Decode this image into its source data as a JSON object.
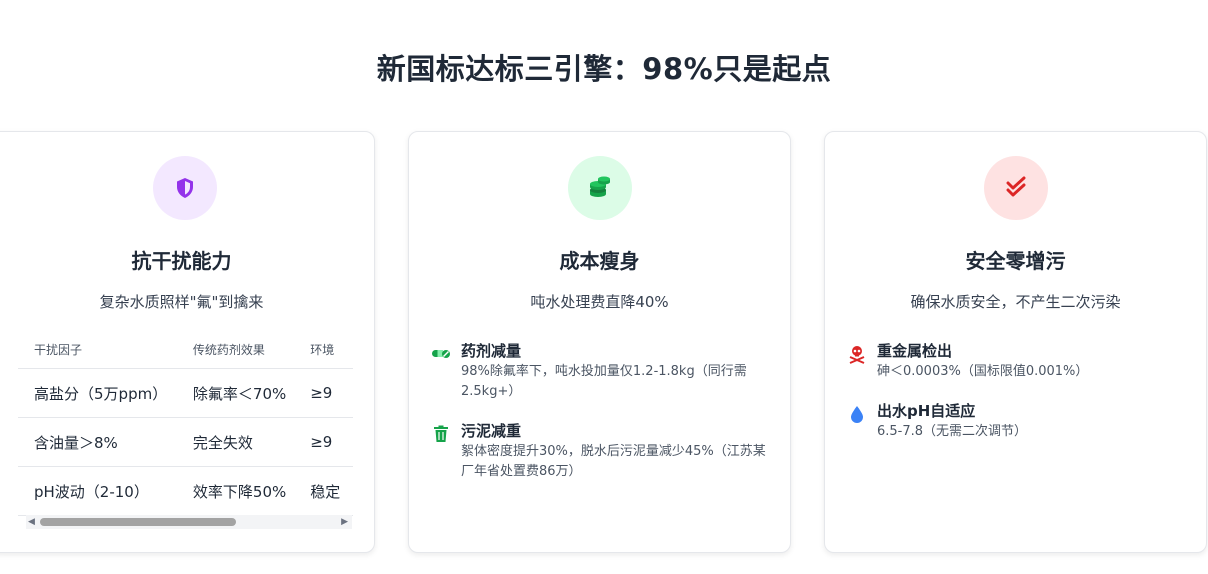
{
  "page": {
    "title": "新国标达标三引擎：98%只是起点"
  },
  "cards": [
    {
      "title": "抗干扰能力",
      "subtitle": "复杂水质照样\"氟\"到擒来",
      "icon": "shield-icon",
      "icon_bg": "#f3e8ff",
      "icon_color": "#9333ea",
      "table": {
        "headers": [
          "干扰因子",
          "传统药剂效果",
          "环境"
        ],
        "rows": [
          [
            "高盐分（5万ppm）",
            "除氟率＜70%",
            "≥9"
          ],
          [
            "含油量＞8%",
            "完全失效",
            "≥9"
          ],
          [
            "pH波动（2-10）",
            "效率下降50%",
            "稳定"
          ]
        ]
      }
    },
    {
      "title": "成本瘦身",
      "subtitle": "吨水处理费直降40%",
      "icon": "coins-icon",
      "icon_bg": "#dcfce7",
      "icon_color": "#16a34a",
      "features": [
        {
          "icon": "pills-icon",
          "title": "药剂减量",
          "desc": "98%除氟率下，吨水投加量仅1.2-1.8kg（同行需2.5kg+）"
        },
        {
          "icon": "trash-icon",
          "title": "污泥减重",
          "desc": "絮体密度提升30%，脱水后污泥量减少45%（江苏某厂年省处置费86万）"
        }
      ]
    },
    {
      "title": "安全零增污",
      "subtitle": "确保水质安全，不产生二次污染",
      "icon": "double-check-icon",
      "icon_bg": "#fee2e2",
      "icon_color": "#dc2626",
      "features": [
        {
          "icon": "skull-crossbones-icon",
          "title": "重金属检出",
          "desc": "砷＜0.0003%（国标限值0.001%）"
        },
        {
          "icon": "water-drop-icon",
          "title": "出水pH自适应",
          "desc": "6.5-7.8（无需二次调节）"
        }
      ]
    }
  ]
}
